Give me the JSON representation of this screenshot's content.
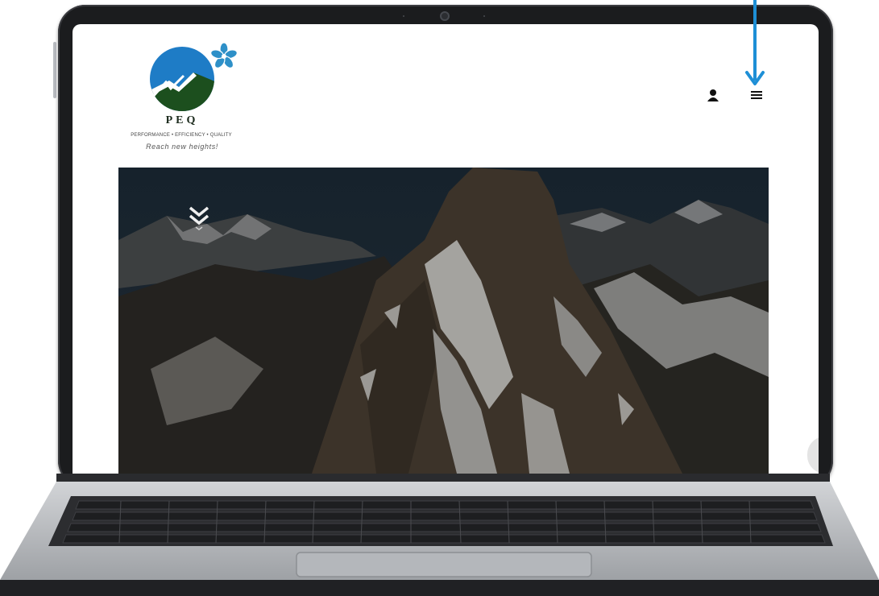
{
  "brand": {
    "name": "PEQ",
    "tagline": "PERFORMANCE • EFFICIENCY • QUALITY",
    "slogan": "Reach new heights!",
    "colors": {
      "sky_blue": "#1e7cc6",
      "forest_green": "#1c4f1e",
      "flower_blue": "#2e90c8"
    }
  },
  "header": {
    "account_icon": "user-icon",
    "menu_icon": "hamburger-menu-icon"
  },
  "hero": {
    "scroll_icon": "double-chevron-down-icon",
    "image": "mountain-peak"
  },
  "annotation": {
    "arrow_color": "#1e8fd6",
    "arrow_icon": "arrow-down-icon"
  }
}
